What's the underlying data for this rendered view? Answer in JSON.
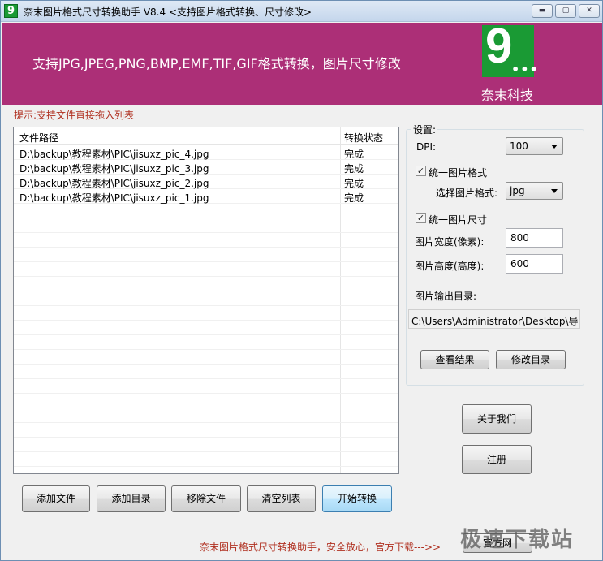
{
  "window": {
    "title": "奈末图片格式尺寸转换助手 V8.4    <支持图片格式转换、尺寸修改>",
    "icon_label": "9",
    "min_glyph": "▬",
    "max_glyph": "▢",
    "close_glyph": "✕"
  },
  "banner": {
    "slogan": "支持JPG,JPEG,PNG,BMP,EMF,TIF,GIF格式转换，图片尺寸修改",
    "logo_text": "9",
    "logo_dots": "•••",
    "brand": "奈末科技",
    "color": "#ac2f77"
  },
  "hint": "提示:支持文件直接拖入列表",
  "file_list": {
    "columns": [
      "文件路径",
      "转换状态"
    ],
    "rows": [
      {
        "path": "D:\\backup\\教程素材\\PIC\\jisuxz_pic_4.jpg",
        "status": "完成"
      },
      {
        "path": "D:\\backup\\教程素材\\PIC\\jisuxz_pic_3.jpg",
        "status": "完成"
      },
      {
        "path": "D:\\backup\\教程素材\\PIC\\jisuxz_pic_2.jpg",
        "status": "完成"
      },
      {
        "path": "D:\\backup\\教程素材\\PIC\\jisuxz_pic_1.jpg",
        "status": "完成"
      }
    ]
  },
  "toolbar": {
    "add_file": "添加文件",
    "add_dir": "添加目录",
    "remove_file": "移除文件",
    "clear_list": "清空列表",
    "start": "开始转换"
  },
  "settings": {
    "title": "设置:",
    "dpi_label": "DPI:",
    "dpi_value": "100",
    "unify_format_label": "统一图片格式",
    "unify_format_checked": "✓",
    "choose_format_label": "选择图片格式:",
    "format_value": "jpg",
    "unify_size_label": "统一图片尺寸",
    "unify_size_checked": "✓",
    "width_label": "图片宽度(像素):",
    "width_value": "800",
    "height_label": "图片高度(高度):",
    "height_value": "600",
    "output_label": "图片输出目录:",
    "output_dir": "C:\\Users\\Administrator\\Desktop\\导出",
    "view_result": "查看结果",
    "change_dir": "修改目录"
  },
  "side": {
    "about": "关于我们",
    "register": "注册"
  },
  "footer": {
    "text": "奈末图片格式尺寸转换助手，安全放心，官方下载--->>",
    "website": "官方网",
    "watermark": "极速下载站"
  }
}
